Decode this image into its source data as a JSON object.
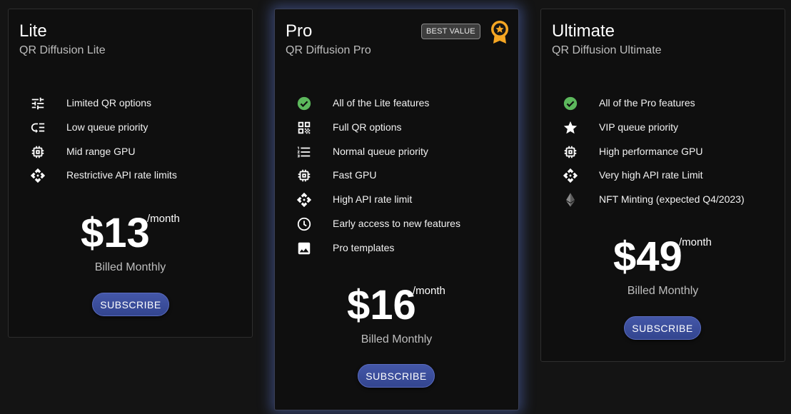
{
  "cards": [
    {
      "title": "Lite",
      "subtitle": "QR Diffusion Lite",
      "features": [
        {
          "icon": "tune-icon",
          "label": "Limited QR options"
        },
        {
          "icon": "low-priority-icon",
          "label": "Low queue priority"
        },
        {
          "icon": "cpu-icon",
          "label": "Mid range GPU"
        },
        {
          "icon": "api-icon",
          "label": "Restrictive API rate limits"
        }
      ],
      "price": "$13",
      "per": "/month",
      "billed": "Billed Monthly",
      "subscribe_label": "SUBSCRIBE"
    },
    {
      "title": "Pro",
      "subtitle": "QR Diffusion Pro",
      "badge": "BEST VALUE",
      "features": [
        {
          "icon": "check-circle-icon",
          "label": "All of the Lite features"
        },
        {
          "icon": "qr-code-icon",
          "label": "Full QR options"
        },
        {
          "icon": "numbered-list-icon",
          "label": "Normal queue priority"
        },
        {
          "icon": "cpu-icon",
          "label": "Fast GPU"
        },
        {
          "icon": "api-icon",
          "label": "High API rate limit"
        },
        {
          "icon": "clock-icon",
          "label": "Early access to new features"
        },
        {
          "icon": "image-icon",
          "label": "Pro templates"
        }
      ],
      "price": "$16",
      "per": "/month",
      "billed": "Billed Monthly",
      "subscribe_label": "SUBSCRIBE"
    },
    {
      "title": "Ultimate",
      "subtitle": "QR Diffusion Ultimate",
      "features": [
        {
          "icon": "check-circle-icon",
          "label": "All of the Pro features"
        },
        {
          "icon": "star-icon",
          "label": "VIP queue priority"
        },
        {
          "icon": "cpu-icon",
          "label": "High performance GPU"
        },
        {
          "icon": "api-icon",
          "label": "Very high API rate Limit"
        },
        {
          "icon": "ethereum-icon",
          "label": "NFT Minting (expected Q4/2023)"
        }
      ],
      "price": "$49",
      "per": "/month",
      "billed": "Billed Monthly",
      "subscribe_label": "SUBSCRIBE"
    }
  ],
  "colors": {
    "background": "#141414",
    "card": "#0f0f0f",
    "accent": "#3d50a0",
    "check": "#5cb85c",
    "award": "#f5a623",
    "glow": "#5a78d2"
  }
}
